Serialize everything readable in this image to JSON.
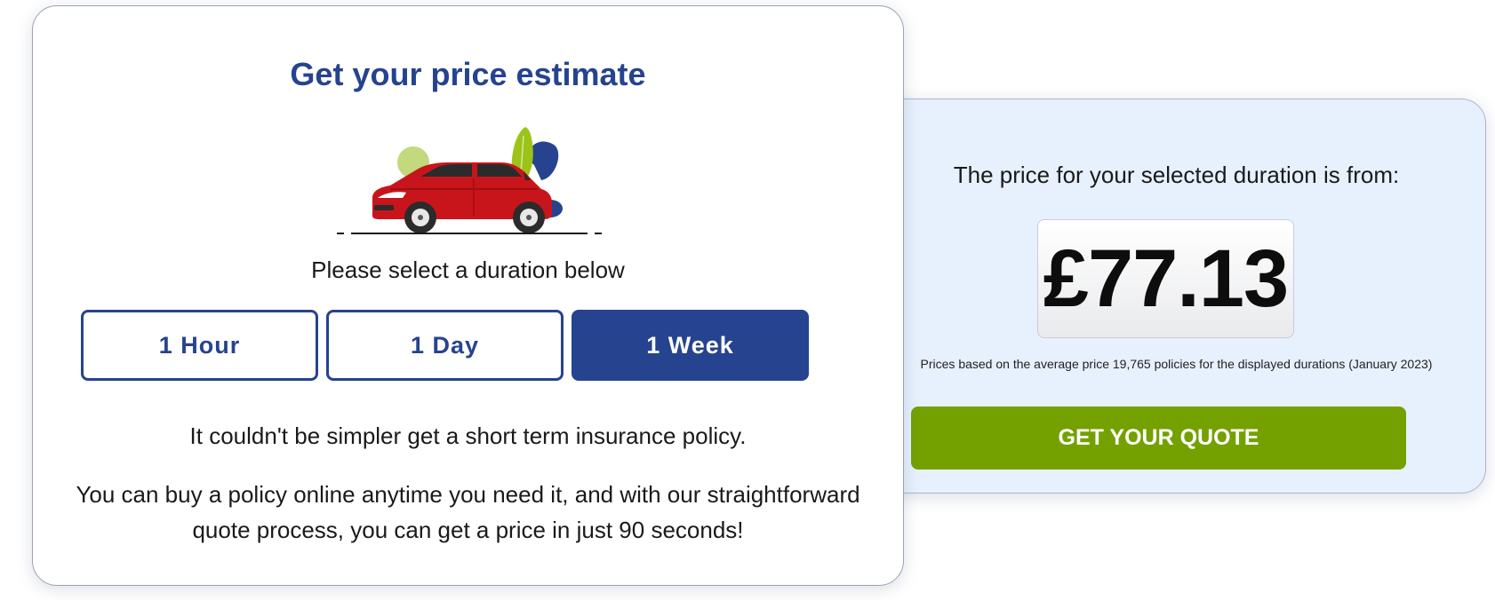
{
  "estimator": {
    "title": "Get your price estimate",
    "select_prompt": "Please select a duration below",
    "durations": [
      {
        "label": "1 Hour",
        "selected": false
      },
      {
        "label": "1 Day",
        "selected": false
      },
      {
        "label": "1 Week",
        "selected": true
      }
    ],
    "intro_text": "It couldn't be simpler get a short term insurance policy.",
    "body_text": "You can buy a policy online anytime you need it, and with our straightforward quote process, you can get a price in just 90 seconds!",
    "illustration": "red-car-icon"
  },
  "price_panel": {
    "label": "The price for your selected duration is from:",
    "price": "£77.13",
    "disclaimer": "Prices based on the average price 19,765 policies for the displayed durations (January 2023)",
    "cta_label": "GET YOUR QUOTE"
  },
  "colors": {
    "brand_blue": "#26438f",
    "cta_green": "#74a100",
    "panel_background": "#e7f0fd",
    "car_red": "#c8151b"
  }
}
